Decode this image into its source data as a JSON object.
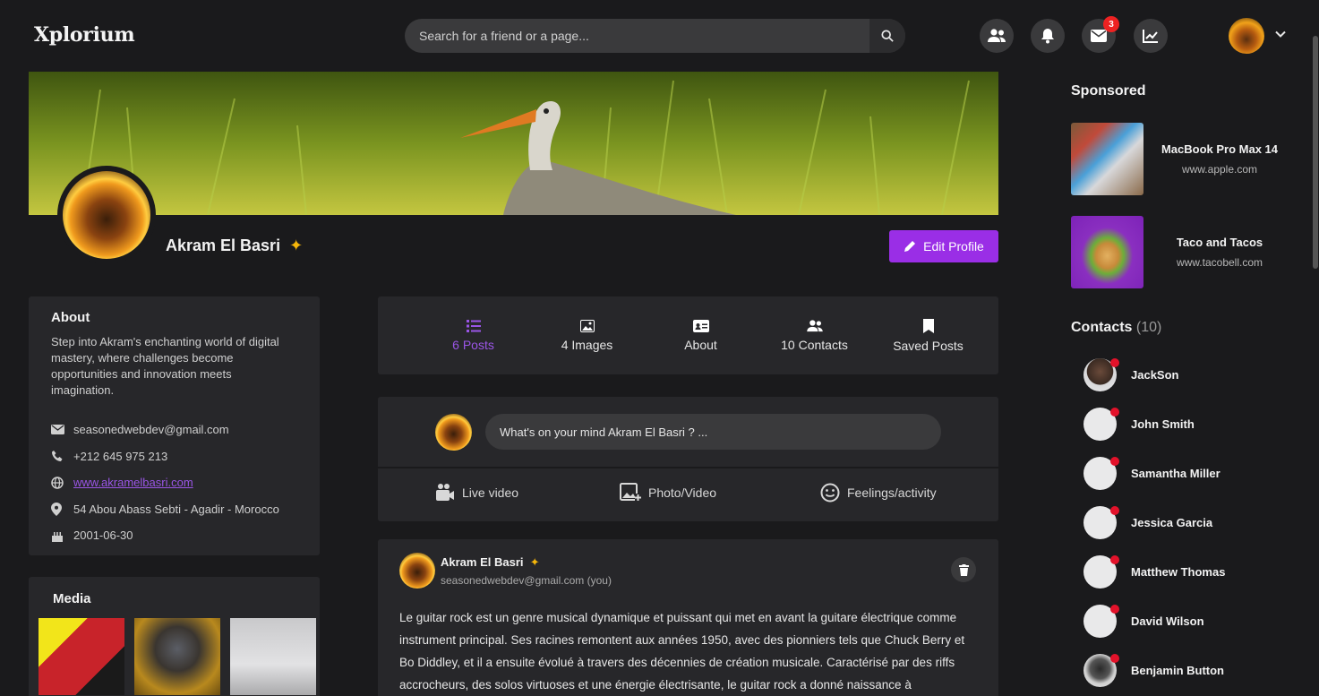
{
  "app": {
    "logo": "Xplorium"
  },
  "search": {
    "placeholder": "Search for a friend or a page..."
  },
  "nav": {
    "messages_badge": "3"
  },
  "profile": {
    "name": "Akram El Basri",
    "edit_label": "Edit Profile"
  },
  "about": {
    "title": "About",
    "description": "Step into Akram's enchanting world of digital mastery, where challenges become opportunities and innovation meets imagination.",
    "email": "seasonedwebdev@gmail.com",
    "phone": "+212 645 975 213",
    "website": "www.akramelbasri.com",
    "address": "54 Abou Abass Sebti - Agadir - Morocco",
    "birthday": "2001-06-30"
  },
  "media": {
    "title": "Media"
  },
  "tabs": [
    {
      "label": "6 Posts",
      "icon": "list-icon"
    },
    {
      "label": "4 Images",
      "icon": "image-icon"
    },
    {
      "label": "About",
      "icon": "id-card-icon"
    },
    {
      "label": "10 Contacts",
      "icon": "users-icon"
    },
    {
      "label": "Saved Posts",
      "icon": "bookmark-icon"
    }
  ],
  "composer": {
    "placeholder": "What's on your mind Akram El Basri ? ...",
    "live_label": "Live video",
    "photo_label": "Photo/Video",
    "feeling_label": "Feelings/activity"
  },
  "post": {
    "author": "Akram El Basri",
    "email": "seasonedwebdev@gmail.com (you)",
    "text": "Le guitar rock est un genre musical dynamique et puissant qui met en avant la guitare électrique comme instrument principal. Ses racines remontent aux années 1950, avec des pionniers tels que Chuck Berry et Bo Diddley, et il a ensuite évolué à travers des décennies de création musicale. Caractérisé par des riffs accrocheurs, des solos virtuoses et une énergie électrisante, le guitar rock a donné naissance à"
  },
  "sponsored": {
    "title": "Sponsored",
    "items": [
      {
        "title": "MacBook Pro Max 14",
        "url": "www.apple.com"
      },
      {
        "title": "Taco and Tacos",
        "url": "www.tacobell.com"
      }
    ]
  },
  "contacts": {
    "title": "Contacts",
    "count": "(10)",
    "items": [
      {
        "name": "JackSon"
      },
      {
        "name": "John Smith"
      },
      {
        "name": "Samantha Miller"
      },
      {
        "name": "Jessica Garcia"
      },
      {
        "name": "Matthew Thomas"
      },
      {
        "name": "David Wilson"
      },
      {
        "name": "Benjamin Button"
      }
    ]
  },
  "colors": {
    "accent": "#9a2ee6",
    "background": "#1a1a1c",
    "panel": "#27272a",
    "status": "#e3122a"
  }
}
